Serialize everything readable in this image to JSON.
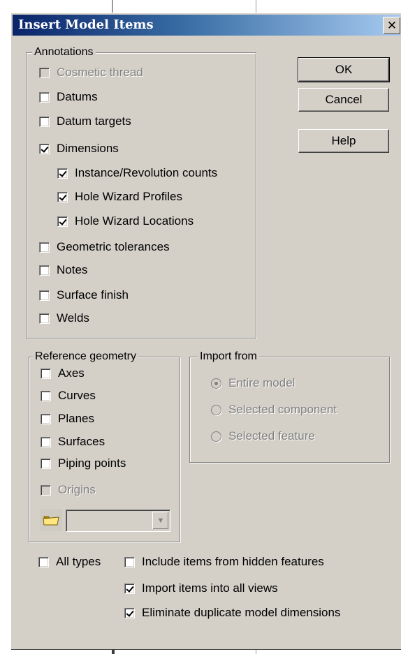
{
  "dialog": {
    "title": "Insert Model Items",
    "close_icon": "close-icon"
  },
  "annotations": {
    "label": "Annotations",
    "items": [
      {
        "label": "Cosmetic thread",
        "checked": false,
        "enabled": false
      },
      {
        "label": "Datums",
        "checked": false,
        "enabled": true
      },
      {
        "label": "Datum targets",
        "checked": false,
        "enabled": true
      },
      {
        "label": "Dimensions",
        "checked": true,
        "enabled": true
      },
      {
        "label": "Instance/Revolution counts",
        "checked": true,
        "enabled": true
      },
      {
        "label": "Hole Wizard Profiles",
        "checked": true,
        "enabled": true
      },
      {
        "label": "Hole Wizard Locations",
        "checked": true,
        "enabled": true
      },
      {
        "label": "Geometric tolerances",
        "checked": false,
        "enabled": true
      },
      {
        "label": "Notes",
        "checked": false,
        "enabled": true
      },
      {
        "label": "Surface finish",
        "checked": false,
        "enabled": true
      },
      {
        "label": "Welds",
        "checked": false,
        "enabled": true
      }
    ]
  },
  "buttons": {
    "ok": "OK",
    "cancel": "Cancel",
    "help": "Help"
  },
  "reference_geometry": {
    "label": "Reference geometry",
    "items": [
      {
        "label": "Axes",
        "checked": false,
        "enabled": true
      },
      {
        "label": "Curves",
        "checked": false,
        "enabled": true
      },
      {
        "label": "Planes",
        "checked": false,
        "enabled": true
      },
      {
        "label": "Surfaces",
        "checked": false,
        "enabled": true
      },
      {
        "label": "Piping points",
        "checked": false,
        "enabled": true
      },
      {
        "label": "Origins",
        "checked": false,
        "enabled": false
      }
    ],
    "layer_icon": "folder-icon",
    "layer_value": ""
  },
  "import_from": {
    "label": "Import from",
    "options": [
      {
        "label": "Entire model",
        "selected": true
      },
      {
        "label": "Selected component",
        "selected": false
      },
      {
        "label": "Selected feature",
        "selected": false
      }
    ]
  },
  "options": {
    "all_types": {
      "label": "All types",
      "checked": false
    },
    "include_hidden": {
      "label": "Include items from hidden features",
      "checked": false
    },
    "import_all_views": {
      "label": "Import items into all views",
      "checked": true
    },
    "eliminate_duplicates": {
      "label": "Eliminate duplicate model dimensions",
      "checked": true
    }
  },
  "colors": {
    "dialog_face": "#d4d0c8",
    "title_active": "#0a246a",
    "disabled_text": "#808080"
  }
}
